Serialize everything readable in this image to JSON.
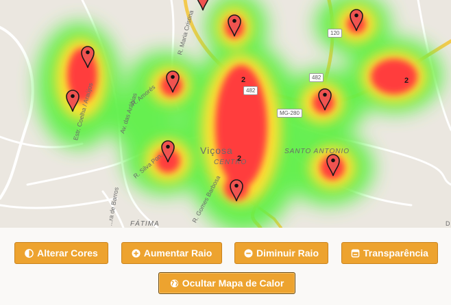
{
  "map": {
    "streets": [
      "Estr. Coelha / Araújos",
      "Av. das Arábias",
      "R. Amorés",
      "R. Maria Cristina",
      "R. Silva Pon...",
      "R. Gomes Barbosa",
      "...ra de Barros"
    ],
    "places": {
      "vicosa": "Viçosa",
      "centro": "CENTRO",
      "santo_antonio": "SANTO ANTONIO",
      "fatima": "FÁTIMA"
    },
    "road_badges": [
      "482",
      "482",
      "MG-280",
      "120"
    ],
    "cluster_counts": [
      "2",
      "2",
      "2"
    ],
    "attribution": "D",
    "marker_count": 10,
    "colors": {
      "hot": "#ff3c3c",
      "warm": "#ffe033",
      "cool": "#5ef04a",
      "pin": "#ef5350"
    }
  },
  "buttons": {
    "alterar_cores": "Alterar Cores",
    "aumentar_raio": "Aumentar Raio",
    "diminuir_raio": "Diminuir Raio",
    "transparencia": "Transparência",
    "ocultar_mapa": "Ocultar Mapa de Calor"
  }
}
